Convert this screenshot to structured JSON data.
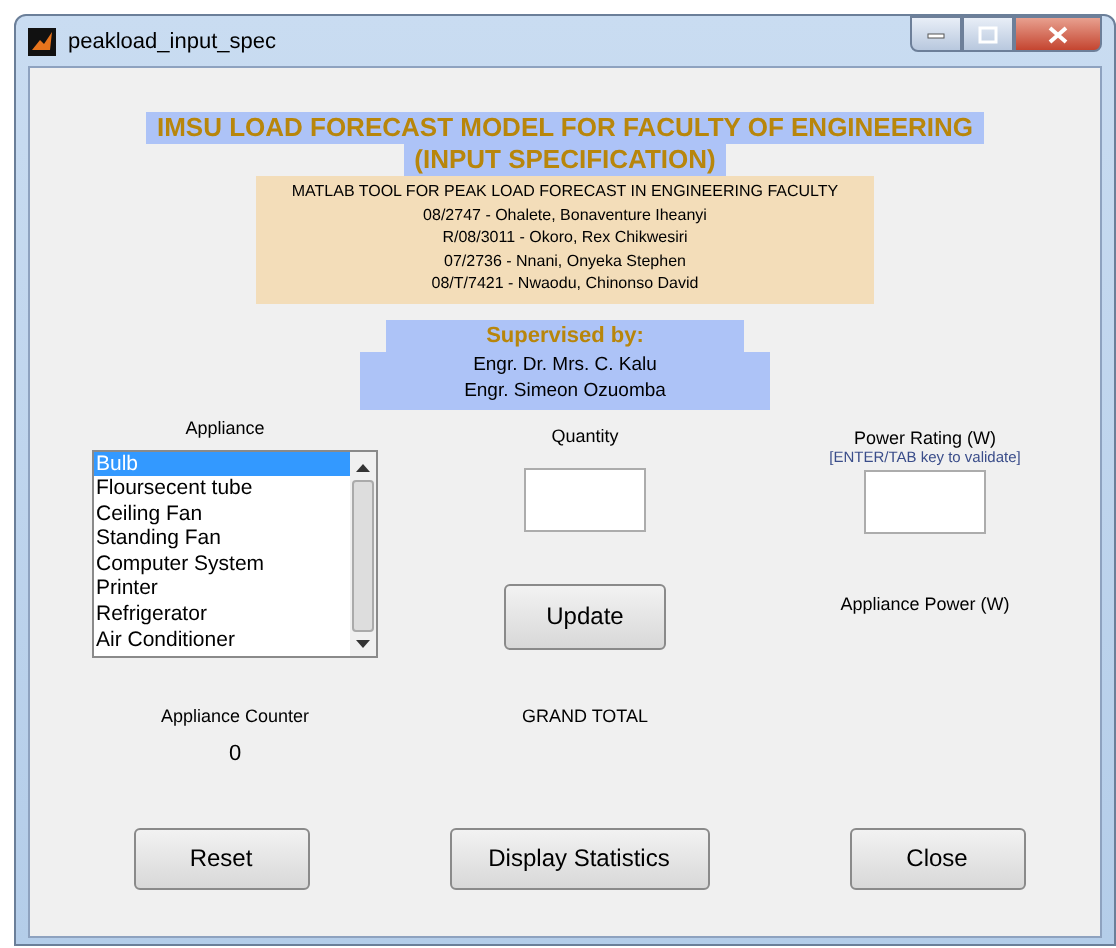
{
  "window": {
    "title": "peakload_input_spec"
  },
  "header": {
    "title_lines": [
      "IMSU LOAD FORECAST MODEL FOR FACULTY OF ENGINEERING",
      "(INPUT SPECIFICATION)"
    ],
    "credits": [
      "MATLAB TOOL FOR PEAK LOAD FORECAST IN ENGINEERING FACULTY",
      "08/2747 - Ohalete, Bonaventure Iheanyi",
      "R/08/3011 - Okoro, Rex Chikwesiri",
      "07/2736 - Nnani, Onyeka Stephen",
      "08/T/7421 - Nwaodu, Chinonso David"
    ]
  },
  "supervision": {
    "heading": "Supervised by:",
    "names": [
      "Engr. Dr. Mrs. C. Kalu",
      "Engr. Simeon Ozuomba"
    ]
  },
  "appliance": {
    "label": "Appliance",
    "items": [
      {
        "text": "Bulb",
        "selected": true
      },
      {
        "text": "Floursecent tube",
        "selected": false
      },
      {
        "text": "Ceiling Fan",
        "selected": false
      },
      {
        "text": "Standing Fan",
        "selected": false
      },
      {
        "text": "Computer System",
        "selected": false
      },
      {
        "text": "Printer",
        "selected": false
      },
      {
        "text": "Refrigerator",
        "selected": false
      },
      {
        "text": "Air Conditioner",
        "selected": false
      }
    ]
  },
  "quantity": {
    "label": "Quantity"
  },
  "power_rating": {
    "label": "Power Rating (W)",
    "hint": "[ENTER/TAB key to validate]"
  },
  "update_button": "Update",
  "appliance_power": {
    "label": "Appliance Power (W)"
  },
  "counter": {
    "label": "Appliance Counter",
    "value": "0"
  },
  "grand_total": {
    "label": "GRAND TOTAL"
  },
  "buttons": [
    "Reset",
    "Display Statistics",
    "Close"
  ]
}
